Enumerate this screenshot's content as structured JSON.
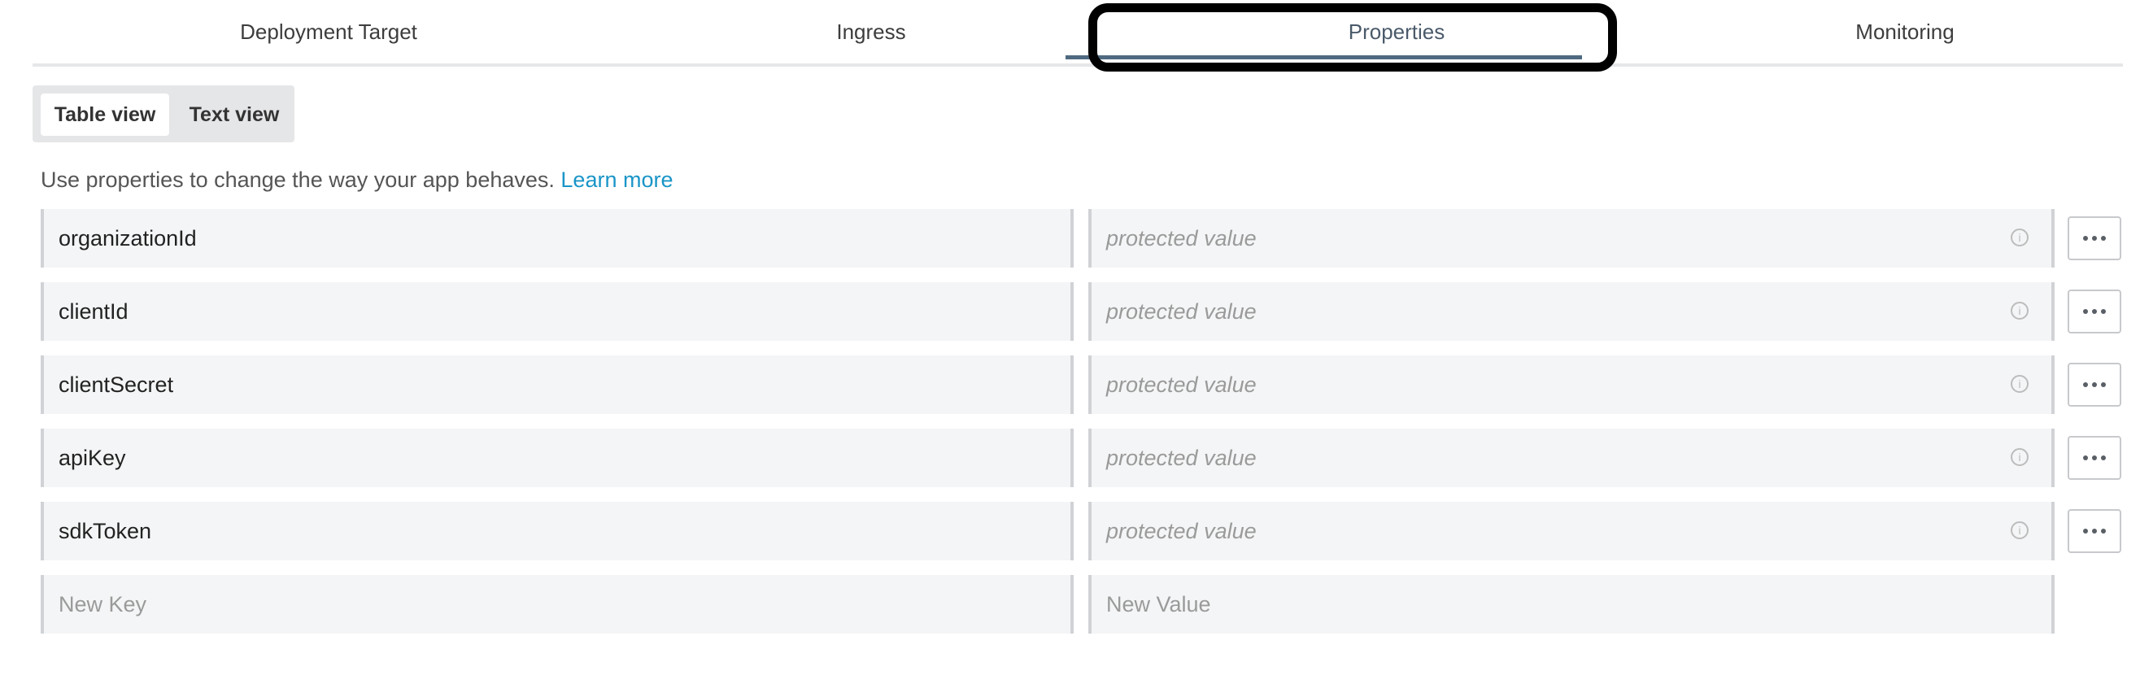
{
  "tabs": [
    {
      "label": "Deployment Target"
    },
    {
      "label": "Ingress"
    },
    {
      "label": "Properties"
    },
    {
      "label": "Monitoring"
    }
  ],
  "view_toggle": {
    "table": "Table view",
    "text": "Text view"
  },
  "description": {
    "text": "Use properties to change the way your app behaves.",
    "link": "Learn more"
  },
  "properties": [
    {
      "key": "organizationId",
      "value": "protected value"
    },
    {
      "key": "clientId",
      "value": "protected value"
    },
    {
      "key": "clientSecret",
      "value": "protected value"
    },
    {
      "key": "apiKey",
      "value": "protected value"
    },
    {
      "key": "sdkToken",
      "value": "protected value"
    }
  ],
  "new_row": {
    "key_placeholder": "New Key",
    "value_placeholder": "New Value"
  },
  "icons": {
    "info": "info-icon",
    "more": "more-options-icon"
  },
  "colors": {
    "link": "#1a95c7",
    "active_tab_underline": "#4f6a80",
    "field_bg": "#f4f5f6"
  }
}
